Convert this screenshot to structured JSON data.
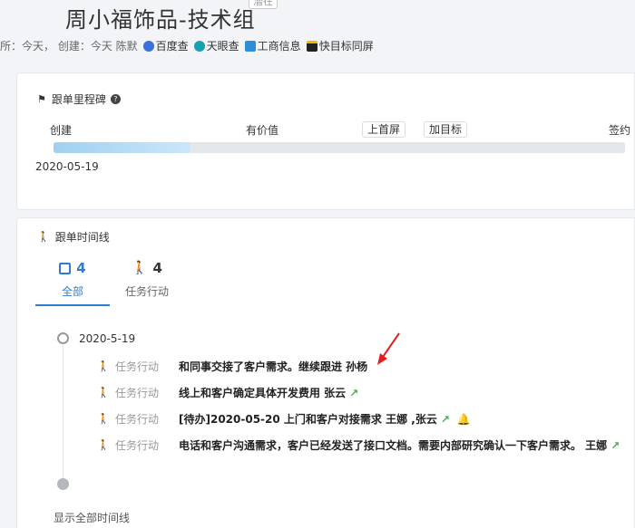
{
  "header": {
    "title": "周小福饰品-技术组",
    "tag": "潜在",
    "meta_text": "所：今天，  创建：今天 陈默",
    "links": [
      {
        "label": "百度查",
        "color": "#3b6fd9"
      },
      {
        "label": "天眼查",
        "color": "#18a0b0"
      },
      {
        "label": "工商信息",
        "color": "#2a8fd6"
      },
      {
        "label": "快目标同屏",
        "color": "#222222"
      }
    ]
  },
  "milestone": {
    "heading": "跟单里程碑",
    "stages": [
      "创建",
      "有价值",
      "上首屏",
      "加目标",
      "签约"
    ],
    "progress_percent": 24,
    "date": "2020-05-19"
  },
  "timeline": {
    "heading": "跟单时间线",
    "tabs": [
      {
        "count": "4",
        "label": "全部",
        "active": true
      },
      {
        "count": "4",
        "label": "任务行动",
        "active": false
      }
    ],
    "date": "2020-5-19",
    "entries": [
      {
        "type": "任务行动",
        "text": "和同事交接了客户需求。继续跟进 孙杨",
        "arrow": false,
        "bell": false
      },
      {
        "type": "任务行动",
        "text": "线上和客户确定具体开发费用 张云",
        "arrow": true,
        "bell": false
      },
      {
        "type": "任务行动",
        "text": "[待办]2020-05-20 上门和客户对接需求 王娜 ,张云",
        "arrow": true,
        "bell": true
      },
      {
        "type": "任务行动",
        "text": "电话和客户沟通需求，客户已经发送了接口文档。需要内部研究确认一下客户需求。 王娜",
        "arrow": true,
        "bell": false
      }
    ],
    "show_all": "显示全部时间线"
  },
  "colors": {
    "accent": "#2f7bd2",
    "progress": "#9fd0f2",
    "annotation": "#e02020"
  }
}
